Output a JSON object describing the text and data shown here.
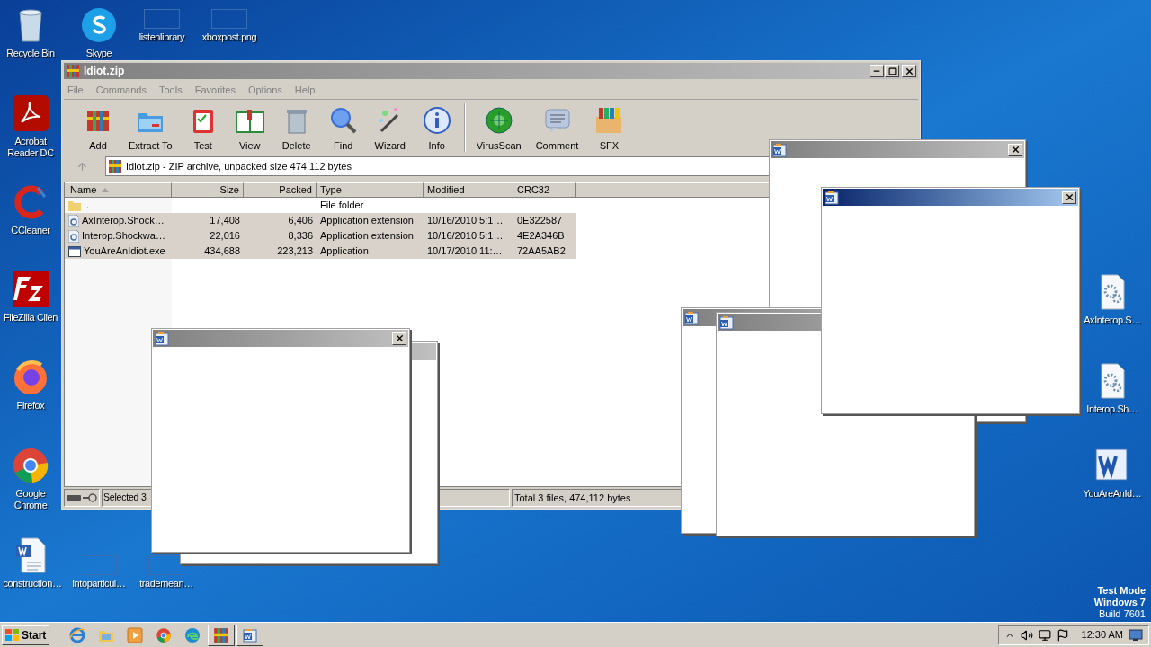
{
  "desktop_icons": [
    {
      "label": "Recycle Bin",
      "kind": "recycle"
    },
    {
      "label": "Skype",
      "kind": "skype"
    },
    {
      "label": "listenlibrary",
      "kind": "blank"
    },
    {
      "label": "xboxpost.png",
      "kind": "blank"
    },
    {
      "label": "Acrobat Reader DC",
      "kind": "acrobat"
    },
    {
      "label": "CCleaner",
      "kind": "ccleaner"
    },
    {
      "label": "FileZilla Clien",
      "kind": "filezilla"
    },
    {
      "label": "Firefox",
      "kind": "firefox"
    },
    {
      "label": "Google Chrome",
      "kind": "chrome"
    },
    {
      "label": "construction…",
      "kind": "worddoc"
    },
    {
      "label": "intoparticul…",
      "kind": "blank"
    },
    {
      "label": "trademean…",
      "kind": "blank"
    },
    {
      "label": "AxInterop.S…",
      "kind": "gears"
    },
    {
      "label": "Interop.Sh…",
      "kind": "gears"
    },
    {
      "label": "YouAreAnId…",
      "kind": "word"
    }
  ],
  "winrar": {
    "title": "Idiot.zip",
    "active": false,
    "menu": [
      "File",
      "Commands",
      "Tools",
      "Favorites",
      "Options",
      "Help"
    ],
    "toolbar": [
      {
        "label": "Add",
        "kind": "add"
      },
      {
        "label": "Extract To",
        "kind": "extract"
      },
      {
        "label": "Test",
        "kind": "test"
      },
      {
        "label": "View",
        "kind": "view"
      },
      {
        "label": "Delete",
        "kind": "delete"
      },
      {
        "label": "Find",
        "kind": "find"
      },
      {
        "label": "Wizard",
        "kind": "wizard"
      },
      {
        "label": "Info",
        "kind": "info"
      },
      {
        "label": "VirusScan",
        "kind": "virus"
      },
      {
        "label": "Comment",
        "kind": "comment"
      },
      {
        "label": "SFX",
        "kind": "sfx"
      }
    ],
    "address": "Idiot.zip - ZIP archive, unpacked size 474,112 bytes",
    "columns": [
      "Name",
      "Size",
      "Packed",
      "Type",
      "Modified",
      "CRC32"
    ],
    "rows": [
      {
        "kind": "folder",
        "selected": false,
        "cells": [
          "..",
          "",
          "",
          "File folder",
          "",
          ""
        ]
      },
      {
        "kind": "dll",
        "selected": true,
        "cells": [
          "AxInterop.Shock…",
          "17,408",
          "6,406",
          "Application extension",
          "10/16/2010 5:1…",
          "0E322587"
        ]
      },
      {
        "kind": "dll",
        "selected": true,
        "cells": [
          "Interop.Shockwa…",
          "22,016",
          "8,336",
          "Application extension",
          "10/16/2010 5:1…",
          "4E2A346B"
        ]
      },
      {
        "kind": "exe",
        "selected": true,
        "cells": [
          "YouAreAnIdiot.exe",
          "434,688",
          "223,213",
          "Application",
          "10/17/2010 11:…",
          "72AA5AB2"
        ]
      }
    ],
    "status_left": "Selected 3",
    "status_right": "Total 3 files, 474,112 bytes"
  },
  "popups": [
    {
      "active": false
    },
    {
      "active": false
    },
    {
      "active": false
    },
    {
      "active": false
    },
    {
      "active": false
    },
    {
      "active": true
    }
  ],
  "watermark_os": [
    "Test Mode",
    "Windows 7",
    "Build 7601"
  ],
  "taskbar": {
    "start": "Start",
    "items": [
      {
        "kind": "ie",
        "running": false
      },
      {
        "kind": "folder",
        "running": false
      },
      {
        "kind": "media",
        "running": false
      },
      {
        "kind": "chrome",
        "running": false
      },
      {
        "kind": "edge",
        "running": false
      },
      {
        "kind": "winrar",
        "running": true
      },
      {
        "kind": "word",
        "running": true
      }
    ],
    "clock": "12:30 AM"
  }
}
